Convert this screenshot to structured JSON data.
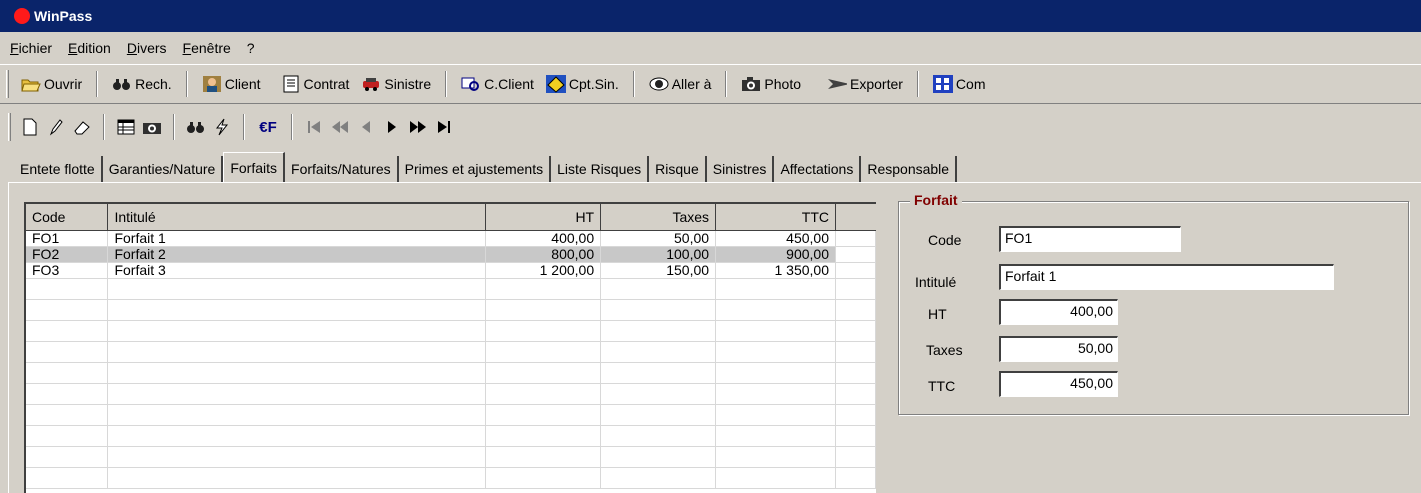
{
  "window": {
    "title": "WinPass"
  },
  "menu": [
    "Fichier",
    "Edition",
    "Divers",
    "Fenêtre",
    "?"
  ],
  "toolbar": {
    "items": [
      {
        "label": "Ouvrir",
        "icon": "open-folder-icon"
      },
      {
        "label": "Rech.",
        "icon": "binoculars-icon"
      },
      {
        "label": "Client",
        "icon": "client-icon"
      },
      {
        "label": "Contrat",
        "icon": "contract-icon"
      },
      {
        "label": "Sinistre",
        "icon": "car-crash-icon"
      },
      {
        "label": "C.Client",
        "icon": "client-account-icon"
      },
      {
        "label": "Cpt.Sin.",
        "icon": "claim-account-icon"
      },
      {
        "label": "Aller à",
        "icon": "eye-icon"
      },
      {
        "label": "Photo",
        "icon": "camera-icon"
      },
      {
        "label": "Exporter",
        "icon": "export-arrow-icon"
      },
      {
        "label": "Com",
        "icon": "grid-icon"
      }
    ]
  },
  "toolbar2": {
    "euro_label": "€F"
  },
  "tabs": [
    "Entete flotte",
    "Garanties/Nature",
    "Forfaits",
    "Forfaits/Natures",
    "Primes et ajustements",
    "Liste Risques",
    "Risque",
    "Sinistres",
    "Affectations",
    "Responsable"
  ],
  "active_tab": "Forfaits",
  "grid": {
    "columns": [
      "Code",
      "Intitulé",
      "HT",
      "Taxes",
      "TTC"
    ],
    "rows": [
      {
        "code": "FO1",
        "intitule": "Forfait 1",
        "ht": "400,00",
        "taxes": "50,00",
        "ttc": "450,00"
      },
      {
        "code": "FO2",
        "intitule": "Forfait 2",
        "ht": "800,00",
        "taxes": "100,00",
        "ttc": "900,00"
      },
      {
        "code": "FO3",
        "intitule": "Forfait 3",
        "ht": "1 200,00",
        "taxes": "150,00",
        "ttc": "1 350,00"
      }
    ]
  },
  "form": {
    "legend": "Forfait",
    "code_label": "Code",
    "code_value": "FO1",
    "intitule_label": "Intitulé",
    "intitule_value": "Forfait 1",
    "ht_label": "HT",
    "ht_value": "400,00",
    "taxes_label": "Taxes",
    "taxes_value": "50,00",
    "ttc_label": "TTC",
    "ttc_value": "450,00"
  }
}
